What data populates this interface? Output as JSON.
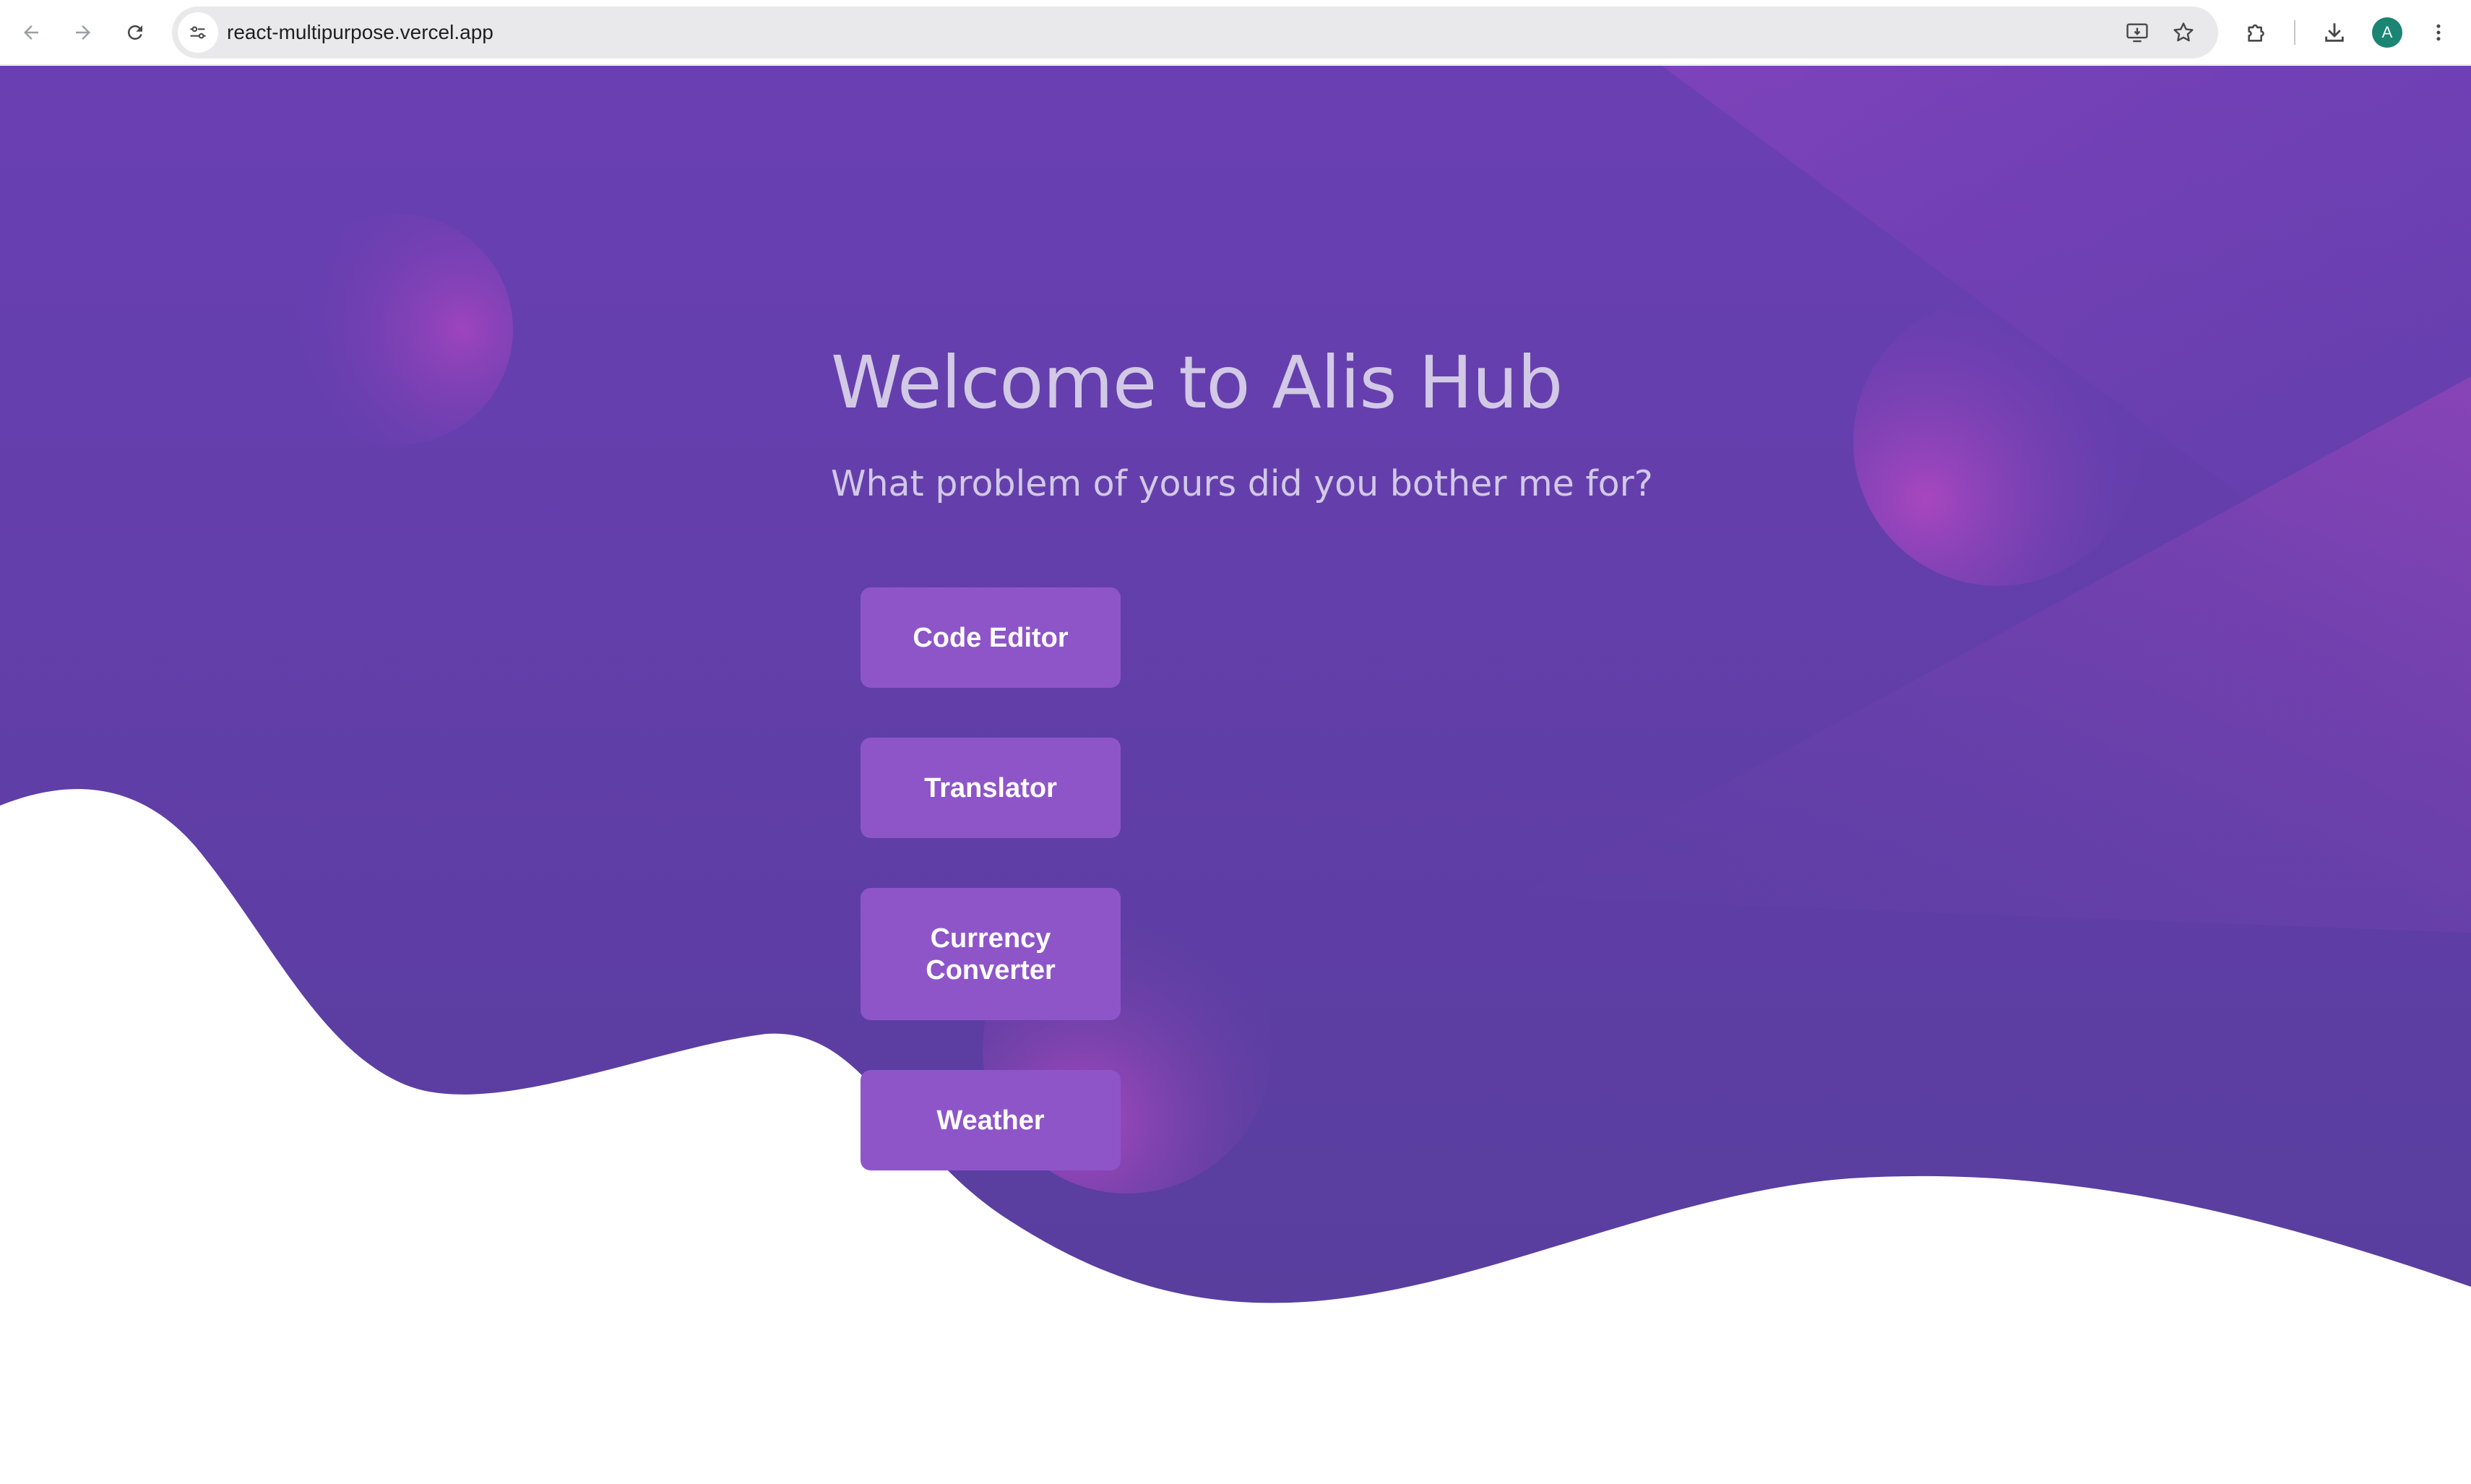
{
  "browser": {
    "url": "react-multipurpose.vercel.app",
    "profile_initial": "A",
    "icons": {
      "back": "arrow-left-icon",
      "forward": "arrow-right-icon",
      "reload": "reload-icon",
      "site_info": "tune-icon",
      "install": "install-app-icon",
      "bookmark": "star-icon",
      "extensions": "puzzle-icon",
      "downloads": "download-icon",
      "menu": "kebab-menu-icon"
    },
    "colors": {
      "avatar": "#1a8573"
    }
  },
  "hero": {
    "title": "Welcome to Alis Hub",
    "subtitle": "What problem of yours did you bother me for?"
  },
  "apps": [
    {
      "label": "Code Editor"
    },
    {
      "label": "Translator"
    },
    {
      "label": "Currency Converter"
    },
    {
      "label": "Weather"
    }
  ],
  "theme": {
    "background_top": "#6a3fb3",
    "background_bottom": "#5a3e9c",
    "button": "#8e55c9",
    "text": "#d2c9e6",
    "accent_pink": "#b548c3"
  }
}
